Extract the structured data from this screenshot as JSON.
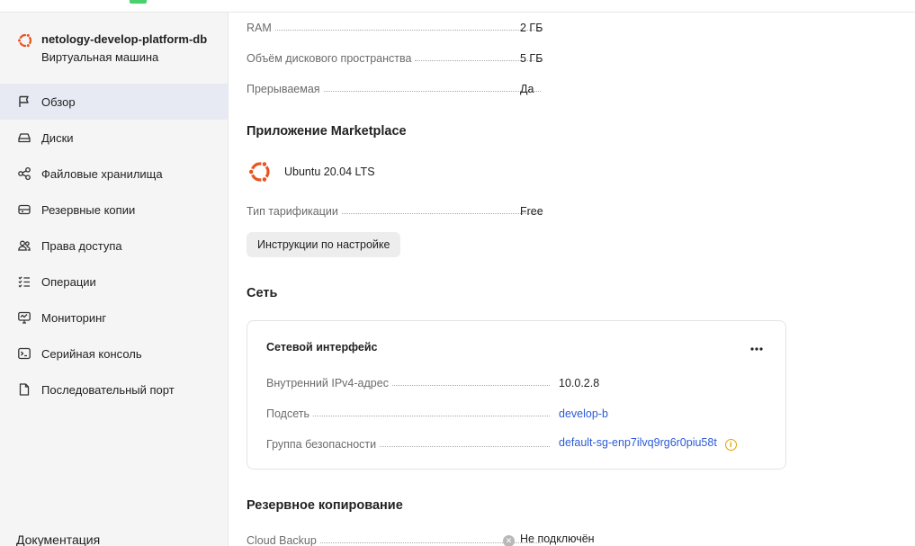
{
  "sidebar": {
    "vm_name": "netology-develop-platform-db",
    "vm_type": "Виртуальная машина",
    "items": [
      {
        "label": "Обзор",
        "icon": "flag-icon",
        "active": true
      },
      {
        "label": "Диски",
        "icon": "disk-icon"
      },
      {
        "label": "Файловые хранилища",
        "icon": "share-nodes-icon"
      },
      {
        "label": "Резервные копии",
        "icon": "backup-drive-icon"
      },
      {
        "label": "Права доступа",
        "icon": "users-icon"
      },
      {
        "label": "Операции",
        "icon": "list-check-icon"
      },
      {
        "label": "Мониторинг",
        "icon": "monitor-icon"
      },
      {
        "label": "Серийная консоль",
        "icon": "terminal-icon"
      },
      {
        "label": "Последовательный порт",
        "icon": "document-icon"
      }
    ],
    "docs_label": "Документация"
  },
  "specs": {
    "ram_label": "RAM",
    "ram_value": "2 ГБ",
    "disk_label": "Объём дискового пространства",
    "disk_value": "5 ГБ",
    "preempt_label": "Прерываемая",
    "preempt_value": "Да"
  },
  "marketplace": {
    "heading": "Приложение Marketplace",
    "app_name": "Ubuntu 20.04 LTS",
    "tariff_label": "Тип тарификации",
    "tariff_value": "Free",
    "instructions_button": "Инструкции по настройке"
  },
  "network": {
    "heading": "Сеть",
    "card_title": "Сетевой интерфейс",
    "ipv4_label": "Внутренний IPv4-адрес",
    "ipv4_value": "10.0.2.8",
    "subnet_label": "Подсеть",
    "subnet_value": "develop-b",
    "sg_label": "Группа безопасности",
    "sg_value": "default-sg-enp7ilvq9rg6r0piu58t"
  },
  "backup": {
    "heading": "Резервное копирование",
    "cloud_label": "Cloud Backup",
    "cloud_value": "Не подключён"
  },
  "colors": {
    "accent": "#2c5bd6",
    "ubuntu": "#e95420",
    "active_bg": "#e7eaf3",
    "sidebar_bg": "#f5f5f6",
    "warning": "#e0a400"
  }
}
